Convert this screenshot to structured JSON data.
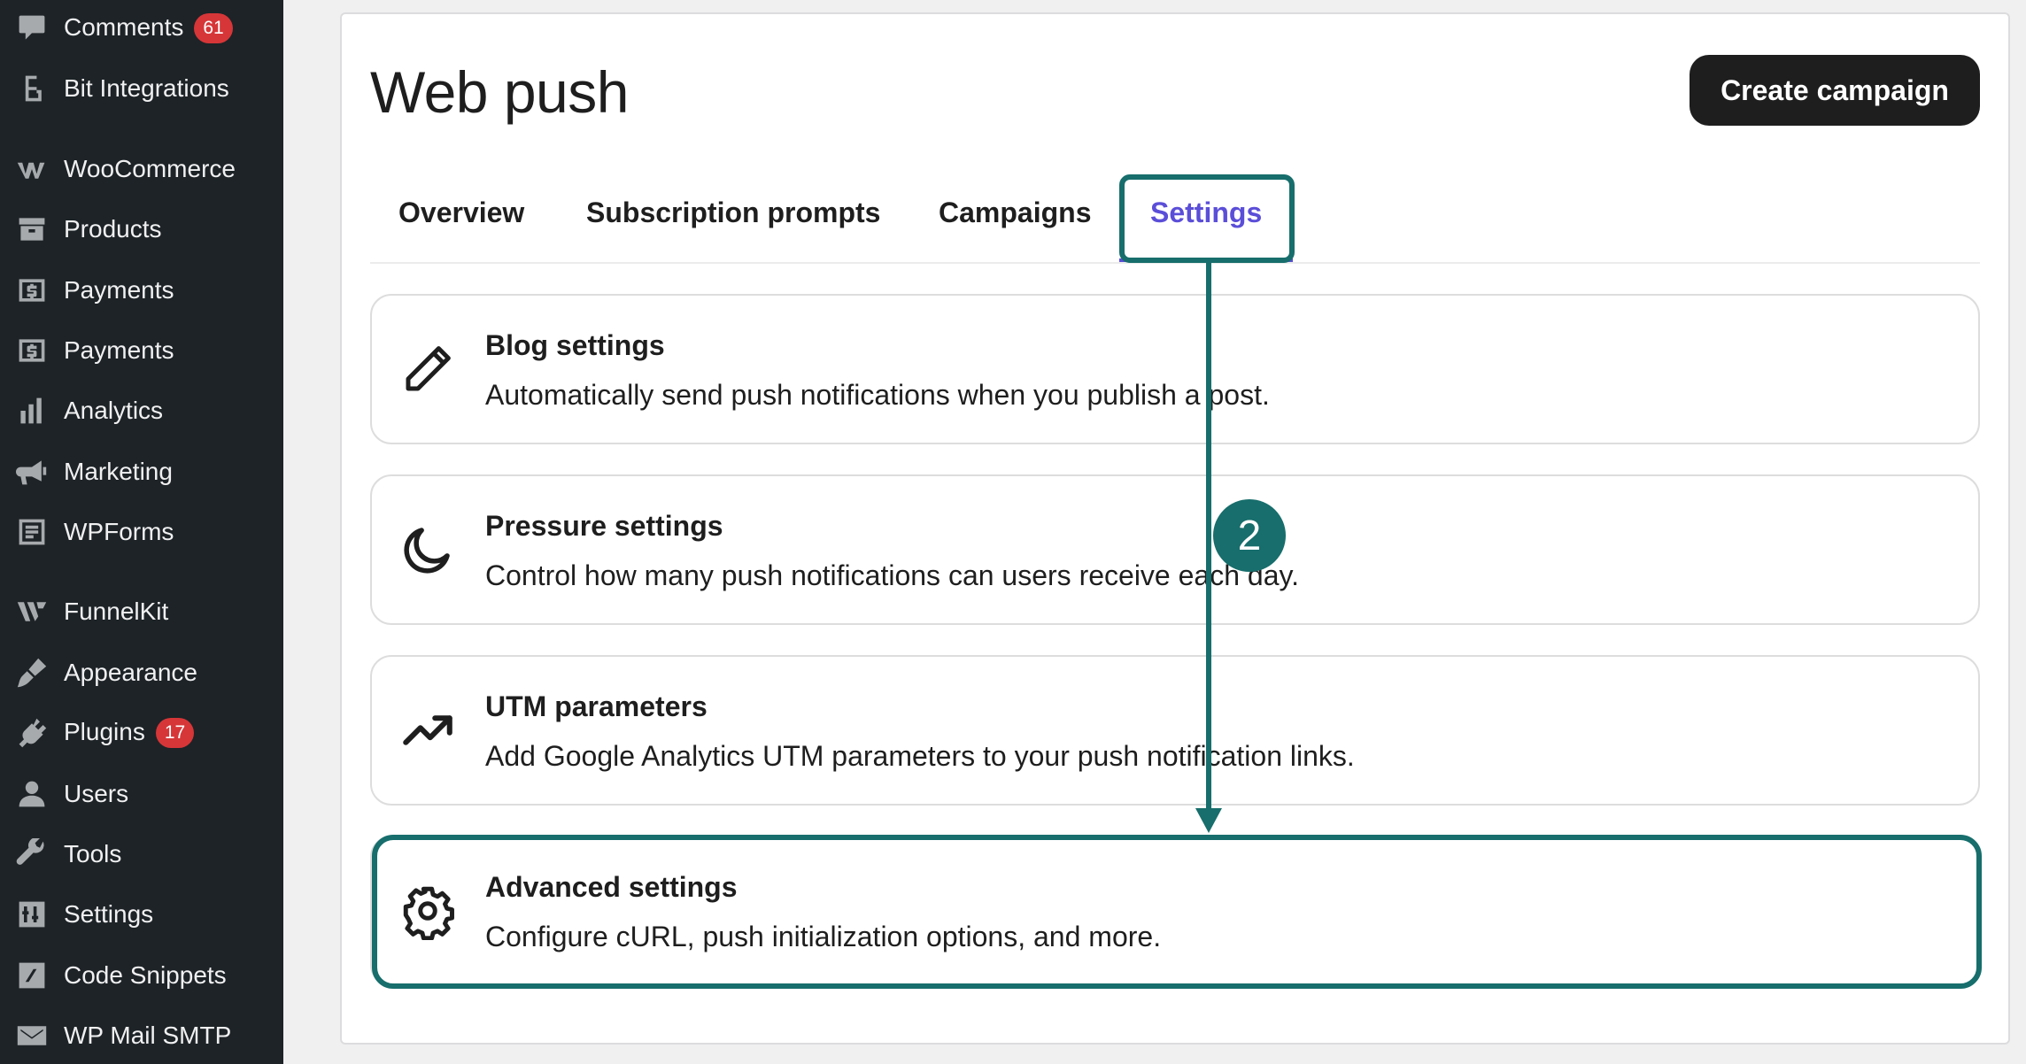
{
  "sidebar": {
    "items": [
      {
        "label": "Comments",
        "badge": "61",
        "icon": "comments-icon"
      },
      {
        "label": "Bit Integrations",
        "badge": "",
        "icon": "bit-integrations-icon"
      },
      {
        "label": "WooCommerce",
        "badge": "",
        "icon": "woocommerce-icon"
      },
      {
        "label": "Products",
        "badge": "",
        "icon": "products-icon"
      },
      {
        "label": "Payments",
        "badge": "",
        "icon": "payments-icon"
      },
      {
        "label": "Payments",
        "badge": "",
        "icon": "payments-icon"
      },
      {
        "label": "Analytics",
        "badge": "",
        "icon": "analytics-icon"
      },
      {
        "label": "Marketing",
        "badge": "",
        "icon": "megaphone-icon"
      },
      {
        "label": "WPForms",
        "badge": "",
        "icon": "wpforms-icon"
      },
      {
        "label": "FunnelKit",
        "badge": "",
        "icon": "funnelkit-icon"
      },
      {
        "label": "Appearance",
        "badge": "",
        "icon": "paintbrush-icon"
      },
      {
        "label": "Plugins",
        "badge": "17",
        "icon": "plug-icon"
      },
      {
        "label": "Users",
        "badge": "",
        "icon": "user-icon"
      },
      {
        "label": "Tools",
        "badge": "",
        "icon": "wrench-icon"
      },
      {
        "label": "Settings",
        "badge": "",
        "icon": "settings-sliders-icon"
      },
      {
        "label": "Code Snippets",
        "badge": "",
        "icon": "code-snippets-icon"
      },
      {
        "label": "WP Mail SMTP",
        "badge": "",
        "icon": "mail-icon"
      }
    ]
  },
  "header": {
    "title": "Web push",
    "create_button": "Create campaign"
  },
  "tabs": [
    {
      "label": "Overview",
      "active": false
    },
    {
      "label": "Subscription prompts",
      "active": false
    },
    {
      "label": "Campaigns",
      "active": false
    },
    {
      "label": "Settings",
      "active": true
    }
  ],
  "settings_cards": [
    {
      "title": "Blog settings",
      "description": "Automatically send push notifications when you publish a post.",
      "icon": "pencil-icon"
    },
    {
      "title": "Pressure settings",
      "description": "Control how many push notifications can users receive each day.",
      "icon": "moon-icon"
    },
    {
      "title": "UTM parameters",
      "description": "Add Google Analytics UTM parameters to your push notification links.",
      "icon": "trending-up-icon"
    },
    {
      "title": "Advanced settings",
      "description": "Configure cURL, push initialization options, and more.",
      "icon": "gear-icon"
    }
  ],
  "annotation": {
    "step_number": "2",
    "color": "#176e6c"
  },
  "colors": {
    "sidebar_bg": "#1d2327",
    "accent_tab": "#5b4ed8",
    "badge": "#d63638",
    "button_bg": "#1e1e1e"
  }
}
